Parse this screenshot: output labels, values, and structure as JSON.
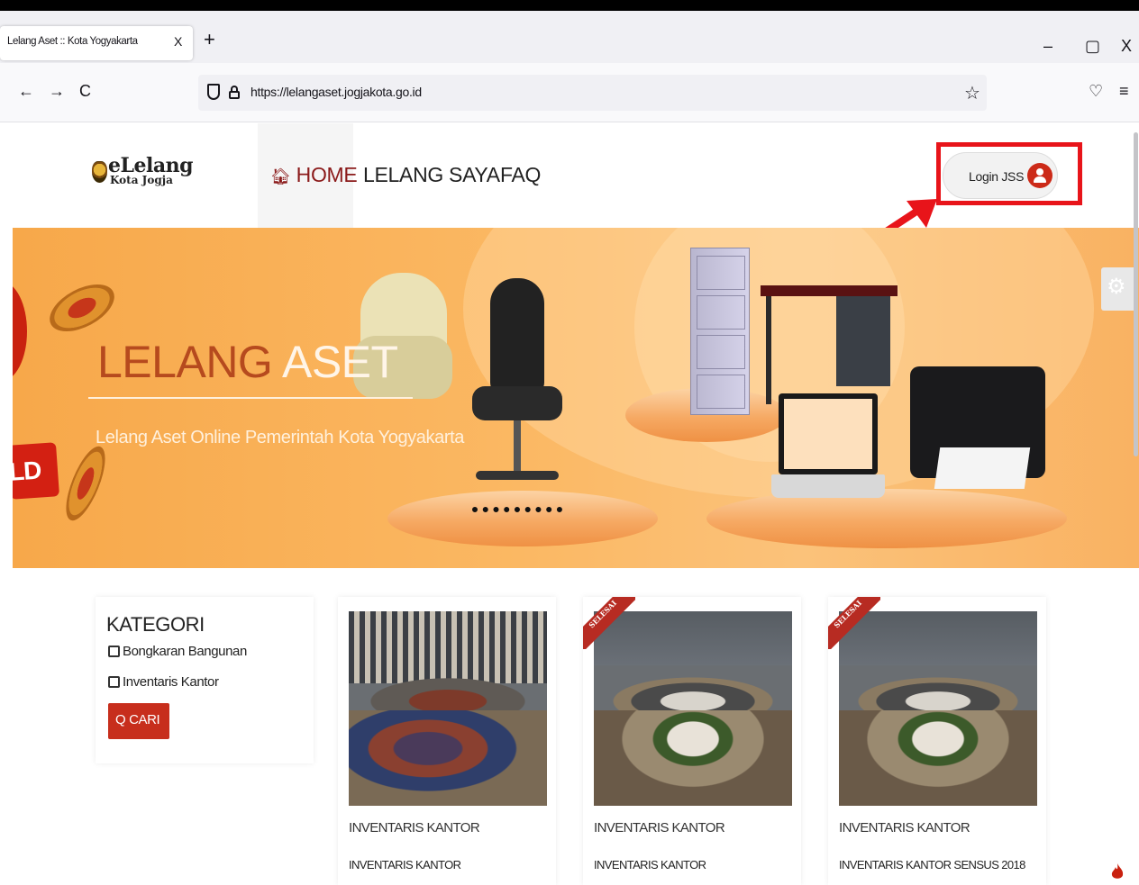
{
  "browser": {
    "tab_title": "Lelang Aset :: Kota Yogyakarta",
    "tab_close": "X",
    "new_tab": "+",
    "url": "https://lelangaset.jogjakota.go.id",
    "window_controls": {
      "minimize": "–",
      "maximize": "▢",
      "close": "X"
    }
  },
  "site": {
    "logo_main": "eLelang",
    "logo_sub": "Kota Jogja",
    "menu": {
      "home": "HOME",
      "lelang_saya": "LELANG SAYA",
      "faq": "FAQ"
    },
    "login_label": "Login JSS"
  },
  "banner": {
    "title_part1": "LELANG",
    "title_part2": "ASET",
    "subtitle": "Lelang Aset Online Pemerintah Kota Yogyakarta",
    "sold_text": "LD"
  },
  "sidebar": {
    "title": "KATEGORI",
    "categories": [
      "Bongkaran Bangunan",
      "Inventaris Kantor"
    ],
    "search_button": "CARI"
  },
  "products": [
    {
      "category": "INVENTARIS KANTOR",
      "name": "INVENTARIS KANTOR",
      "ribbon": ""
    },
    {
      "category": "INVENTARIS KANTOR",
      "name": "INVENTARIS KANTOR",
      "ribbon": "SELESAI"
    },
    {
      "category": "INVENTARIS KANTOR",
      "name": "INVENTARIS KANTOR SENSUS 2018",
      "ribbon": "SELESAI"
    }
  ],
  "colors": {
    "accent_red": "#c72e1c",
    "highlight_red": "#e8141a",
    "banner_orange": "#fbb863",
    "home_active": "#8b1a1a"
  },
  "icons": [
    "back-icon",
    "forward-icon",
    "reload-icon",
    "shield-icon",
    "lock-icon",
    "bookmark-star-icon",
    "pocket-icon",
    "menu-icon",
    "home-icon",
    "user-avatar-icon",
    "search-icon",
    "gear-icon",
    "fire-icon"
  ]
}
